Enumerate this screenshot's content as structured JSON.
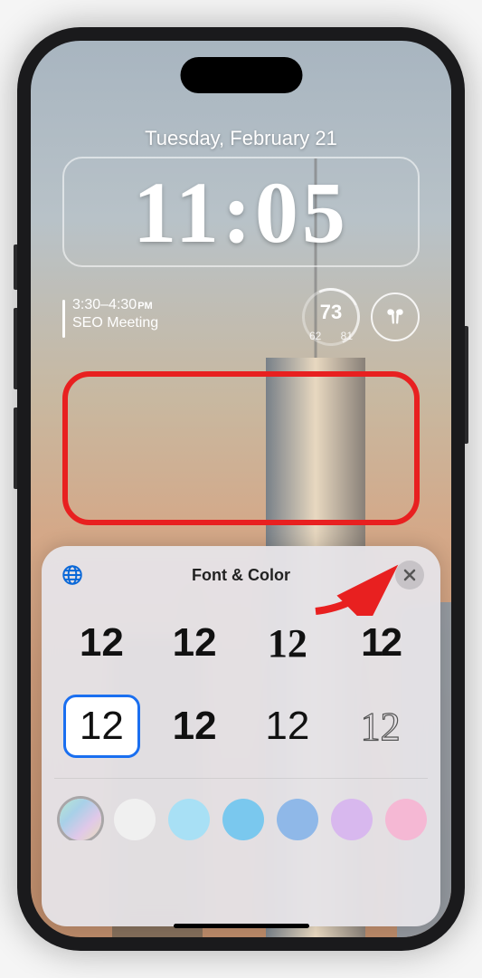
{
  "lockscreen": {
    "date": "Tuesday, February 21",
    "time": "11:05",
    "calendar": {
      "time_range": "3:30–4:30",
      "time_suffix": "PM",
      "title": "SEO Meeting"
    },
    "weather": {
      "current": "73",
      "low": "62",
      "high": "81"
    }
  },
  "sheet": {
    "title": "Font & Color",
    "font_sample": "12",
    "selected_font_index": 4,
    "colors": [
      {
        "css": "linear-gradient(135deg,#b8e8d0,#a8d0e8,#e0c8e8,#e8e0b8)",
        "selected": true
      },
      {
        "css": "#f0f0f0",
        "selected": false
      },
      {
        "css": "#a8e0f5",
        "selected": false
      },
      {
        "css": "#7ac8ee",
        "selected": false
      },
      {
        "css": "#8fb8e8",
        "selected": false
      },
      {
        "css": "#d8b8ee",
        "selected": false
      },
      {
        "css": "#f5b8d4",
        "selected": false
      }
    ]
  }
}
